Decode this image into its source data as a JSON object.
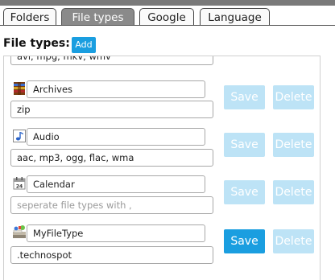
{
  "tabs": [
    {
      "label": "Folders",
      "active": false
    },
    {
      "label": "File types",
      "active": true
    },
    {
      "label": "Google",
      "active": false
    },
    {
      "label": "Language",
      "active": false
    }
  ],
  "heading": "File types:",
  "add_label": "Add",
  "top_partial_value": "avi, mpg, mkv, wmv",
  "rows": [
    {
      "icon": "archive-icon",
      "name": "Archives",
      "extensions": "zip",
      "placeholder": "",
      "save_label": "Save",
      "delete_label": "Delete",
      "save_enabled": false
    },
    {
      "icon": "music-note-icon",
      "name": "Audio",
      "extensions": "aac, mp3, ogg, flac, wma",
      "placeholder": "",
      "save_label": "Save",
      "delete_label": "Delete",
      "save_enabled": false
    },
    {
      "icon": "calendar-icon",
      "name": "Calendar",
      "extensions": "",
      "placeholder": "seperate file types with ,",
      "save_label": "Save",
      "delete_label": "Delete",
      "save_enabled": false
    },
    {
      "icon": "filetype-icon",
      "name": "MyFileType",
      "extensions": ".technospot",
      "placeholder": "",
      "save_label": "Save",
      "delete_label": "Delete",
      "save_enabled": true
    }
  ],
  "colors": {
    "accent": "#1a9ee0",
    "accent_disabled": "#bde3f6",
    "tab_active": "#8a8a8a"
  }
}
